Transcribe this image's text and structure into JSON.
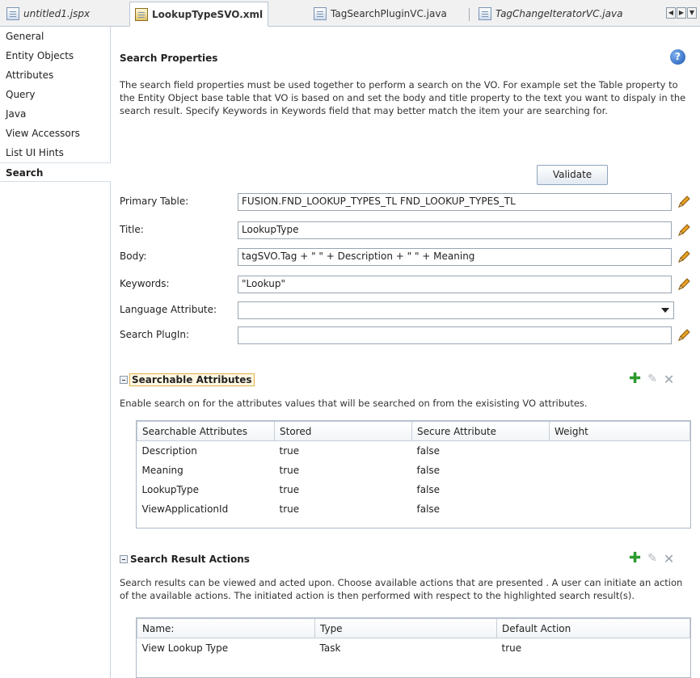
{
  "tabs": [
    {
      "label": "untitled1.jspx"
    },
    {
      "label": "LookupTypeSVO.xml"
    },
    {
      "label": "TagSearchPluginVC.java"
    },
    {
      "label": "TagChangeIteratorVC.java"
    }
  ],
  "sidebar": {
    "items": [
      {
        "label": "General"
      },
      {
        "label": "Entity Objects"
      },
      {
        "label": "Attributes"
      },
      {
        "label": "Query"
      },
      {
        "label": "Java"
      },
      {
        "label": "View Accessors"
      },
      {
        "label": "List UI Hints"
      },
      {
        "label": "Search"
      }
    ],
    "selected": "Search"
  },
  "search": {
    "title": "Search Properties",
    "help_icon": "?",
    "description": "The search field properties must be used together to perform a search on the VO. For example set the Table property to the Entity Object base table that VO is based on and set the body and title property to the text you want to dispaly in the search result. Specify Keywords in Keywords field that may better match the item your are searching for.",
    "validate_label": "Validate",
    "fields": {
      "primary_table": {
        "label": "Primary Table:",
        "value": "FUSION.FND_LOOKUP_TYPES_TL FND_LOOKUP_TYPES_TL"
      },
      "title": {
        "label": "Title:",
        "value": "LookupType"
      },
      "body": {
        "label": "Body:",
        "value": "tagSVO.Tag + \" \" + Description + \" \" + Meaning"
      },
      "keywords": {
        "label": "Keywords:",
        "value": "\"Lookup\""
      },
      "language_attribute": {
        "label": "Language Attribute:",
        "value": ""
      },
      "search_plugin": {
        "label": "Search PlugIn:",
        "value": ""
      }
    }
  },
  "searchable_attributes": {
    "title": "Searchable Attributes",
    "description": "Enable search on for the attributes values that will be searched on from the exisisting VO attributes.",
    "columns": [
      "Searchable Attributes",
      "Stored",
      "Secure Attribute",
      "Weight"
    ],
    "rows": [
      [
        "Description",
        "true",
        "false",
        ""
      ],
      [
        "Meaning",
        "true",
        "false",
        ""
      ],
      [
        "LookupType",
        "true",
        "false",
        ""
      ],
      [
        "ViewApplicationId",
        "true",
        "false",
        ""
      ]
    ]
  },
  "search_result_actions": {
    "title": "Search Result Actions",
    "description": "Search results can be viewed and acted upon. Choose available actions that are presented . A user can initiate an action of the available actions. The initiated action is then performed with respect to the highlighted search result(s).",
    "columns": [
      "Name:",
      "Type",
      "Default Action"
    ],
    "rows": [
      [
        "View Lookup Type",
        "Task",
        "true"
      ]
    ]
  },
  "colors": {
    "accent": "#2c9a2c",
    "tab_border": "#b9c7d6"
  }
}
